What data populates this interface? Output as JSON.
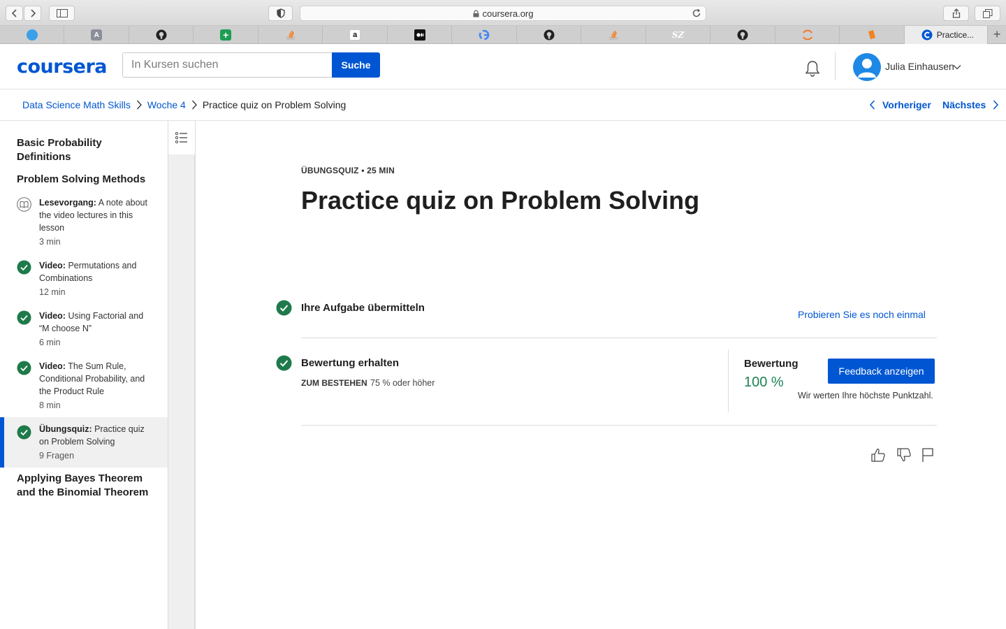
{
  "browser": {
    "url": "coursera.org",
    "tabs": [
      {
        "icon": "globe-icon"
      },
      {
        "icon": "a-app-icon"
      },
      {
        "icon": "github-icon"
      },
      {
        "icon": "plus-sheet-icon"
      },
      {
        "icon": "stack-icon"
      },
      {
        "icon": "amazon-icon"
      },
      {
        "icon": "medium-icon"
      },
      {
        "icon": "google-icon"
      },
      {
        "icon": "github-icon"
      },
      {
        "icon": "stack-icon"
      },
      {
        "icon": "sz-icon"
      },
      {
        "icon": "github-icon"
      },
      {
        "icon": "ring-icon"
      },
      {
        "icon": "book-icon"
      },
      {
        "icon": "coursera-icon",
        "label": "Practice...",
        "active": true
      }
    ],
    "fav_sz_text": "SZ",
    "fav_a_text": "A"
  },
  "header": {
    "logo": "coursera",
    "search_placeholder": "In Kursen suchen",
    "search_button": "Suche",
    "user_name": "Julia Einhausen"
  },
  "breadcrumb": {
    "items": [
      "Data Science Math Skills",
      "Woche 4",
      "Practice quiz on Problem Solving"
    ],
    "prev_label": "Vorheriger",
    "next_label": "Nächstes"
  },
  "sidebar": {
    "sections": [
      "Basic Probability Definitions",
      "Problem Solving Methods",
      "Applying Bayes Theorem and the Binomial Theorem"
    ],
    "items": [
      {
        "type": "Lesevorgang:",
        "title": "A note about the video lectures in this lesson",
        "meta": "3 min",
        "status": "reading"
      },
      {
        "type": "Video:",
        "title": "Permutations and Combinations",
        "meta": "12 min",
        "status": "completed"
      },
      {
        "type": "Video:",
        "title": "Using Factorial and “M choose N”",
        "meta": "6 min",
        "status": "completed"
      },
      {
        "type": "Video:",
        "title": "The Sum Rule, Conditional Probability, and the Product Rule",
        "meta": "8 min",
        "status": "completed"
      },
      {
        "type": "Übungsquiz:",
        "title": "Practice quiz on Problem Solving",
        "meta": "9 Fragen",
        "status": "completed",
        "active": true
      }
    ]
  },
  "main": {
    "kicker": "ÜBUNGSQUIZ • 25 MIN",
    "title": "Practice quiz on Problem Solving",
    "step1_title": "Ihre Aufgabe übermitteln",
    "retry_link": "Probieren Sie es noch einmal",
    "step2_title": "Bewertung erhalten",
    "pass_label": "ZUM BESTEHEN",
    "pass_value": "75 % oder höher",
    "grade_label": "Bewertung",
    "grade_value": "100 %",
    "feedback_button": "Feedback anzeigen",
    "grade_note": "Wir werten Ihre höchste Punktzahl."
  },
  "colors": {
    "brand": "#0056d2",
    "success": "#1f8354",
    "check_fill": "#1f7a4a"
  }
}
